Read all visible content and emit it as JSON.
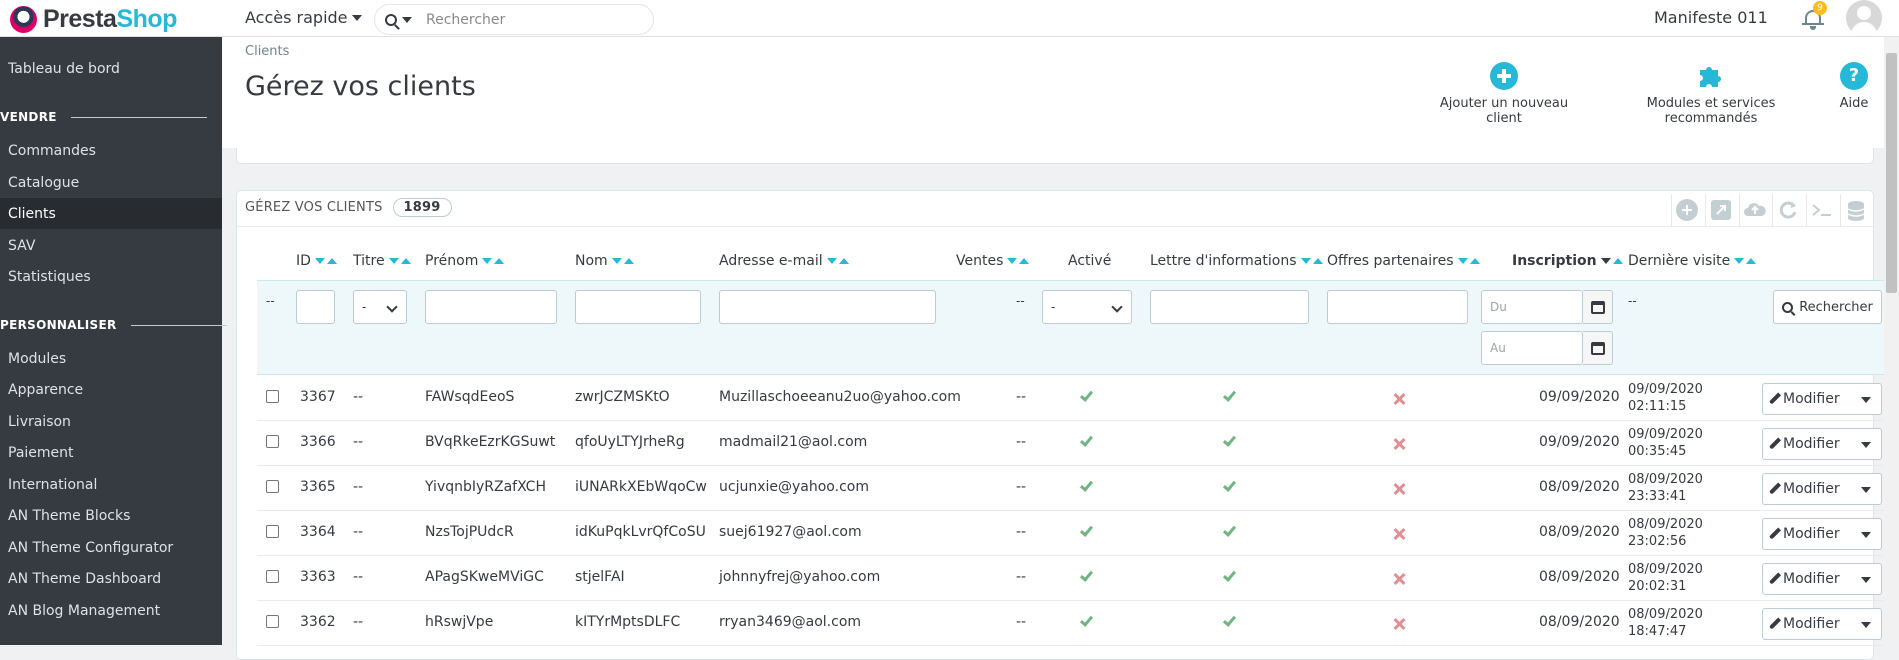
{
  "header": {
    "brand_prefix": "Presta",
    "brand_suffix": "Shop",
    "quick_access": "Accès rapide",
    "search_placeholder": "Rechercher",
    "shop_name": "Manifeste 011",
    "notification_count": "9"
  },
  "sidebar": {
    "dashboard": "Tableau de bord",
    "section_sell": "VENDRE",
    "sell_items": [
      "Commandes",
      "Catalogue",
      "Clients",
      "SAV",
      "Statistiques"
    ],
    "section_custom": "PERSONNALISER",
    "custom_items": [
      "Modules",
      "Apparence",
      "Livraison",
      "Paiement",
      "International",
      "AN Theme Blocks",
      "AN Theme Configurator",
      "AN Theme Dashboard",
      "AN Blog Management"
    ]
  },
  "page": {
    "breadcrumb": "Clients",
    "title": "Gérez vos clients",
    "toolbar": {
      "add": "Ajouter un nouveau client",
      "modules": "Modules et services recommandés",
      "help": "Aide"
    }
  },
  "list": {
    "heading": "GÉREZ VOS CLIENTS",
    "count": "1899",
    "columns": {
      "id": "ID",
      "title": "Titre",
      "firstname": "Prénom",
      "lastname": "Nom",
      "email": "Adresse e-mail",
      "sales": "Ventes",
      "active": "Activé",
      "newsletter": "Lettre d'informations",
      "optin": "Offres partenaires",
      "date_add": "Inscription",
      "last_visit": "Dernière visite"
    },
    "filters": {
      "dash": "--",
      "select_any": "-",
      "date_from": "Du",
      "date_to": "Au",
      "search_button": "Rechercher"
    },
    "empty": "--",
    "edit_label": "Modifier",
    "rows": [
      {
        "id": "3367",
        "title": "--",
        "firstname": "FAWsqdEeoS",
        "lastname": "zwrJCZMSKtO",
        "email": "Muzillaschoeeanu2uo@yahoo.com",
        "sales": "--",
        "active": true,
        "newsletter": true,
        "optin": false,
        "date_add": "09/09/2020",
        "last_visit_date": "09/09/2020",
        "last_visit_time": "02:11:15"
      },
      {
        "id": "3366",
        "title": "--",
        "firstname": "BVqRkeEzrKGSuwt",
        "lastname": "qfoUyLTYJrheRg",
        "email": "madmail21@aol.com",
        "sales": "--",
        "active": true,
        "newsletter": true,
        "optin": false,
        "date_add": "09/09/2020",
        "last_visit_date": "09/09/2020",
        "last_visit_time": "00:35:45"
      },
      {
        "id": "3365",
        "title": "--",
        "firstname": "YivqnbIyRZafXCH",
        "lastname": "iUNARkXEbWqoCw",
        "email": "ucjunxie@yahoo.com",
        "sales": "--",
        "active": true,
        "newsletter": true,
        "optin": false,
        "date_add": "08/09/2020",
        "last_visit_date": "08/09/2020",
        "last_visit_time": "23:33:41"
      },
      {
        "id": "3364",
        "title": "--",
        "firstname": "NzsTojPUdcR",
        "lastname": "idKuPqkLvrQfCoSU",
        "email": "suej61927@aol.com",
        "sales": "--",
        "active": true,
        "newsletter": true,
        "optin": false,
        "date_add": "08/09/2020",
        "last_visit_date": "08/09/2020",
        "last_visit_time": "23:02:56"
      },
      {
        "id": "3363",
        "title": "--",
        "firstname": "APagSKweMViGC",
        "lastname": "stjelFAI",
        "email": "johnnyfrej@yahoo.com",
        "sales": "--",
        "active": true,
        "newsletter": true,
        "optin": false,
        "date_add": "08/09/2020",
        "last_visit_date": "08/09/2020",
        "last_visit_time": "20:02:31"
      },
      {
        "id": "3362",
        "title": "--",
        "firstname": "hRswjVpe",
        "lastname": "kITYrMptsDLFC",
        "email": "rryan3469@aol.com",
        "sales": "--",
        "active": true,
        "newsletter": true,
        "optin": false,
        "date_add": "08/09/2020",
        "last_visit_date": "08/09/2020",
        "last_visit_time": "18:47:47"
      }
    ]
  },
  "colors": {
    "accent": "#25b9d7",
    "sidebar_bg": "#363a41",
    "success": "#70b580",
    "danger": "#e08f95"
  }
}
